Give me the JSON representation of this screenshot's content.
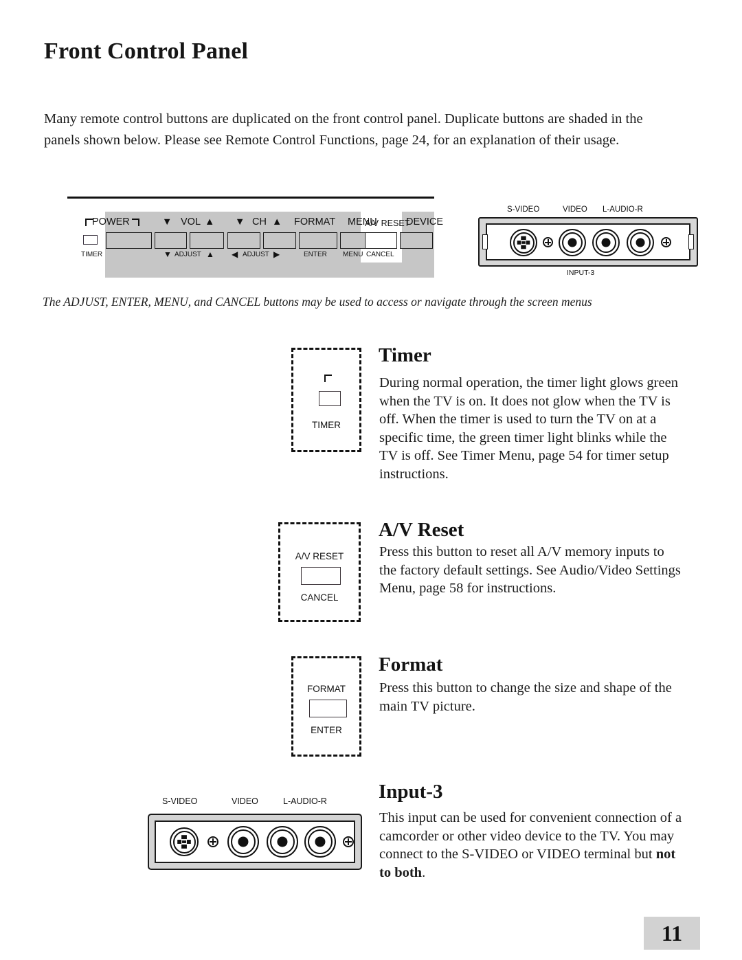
{
  "page": {
    "title": "Front Control Panel",
    "intro": "Many remote control buttons are duplicated on the front control panel.  Duplicate buttons are shaded in the\npanels shown below.  Please see Remote Control Functions, page 24, for an explanation of their usage.",
    "caption": "The ADJUST, ENTER, MENU, and CANCEL buttons may be used to access or navigate through the screen menus",
    "page_number": "11"
  },
  "control_panel": {
    "power_label": "POWER",
    "timer_label": "TIMER",
    "buttons": [
      {
        "top": "POWER",
        "bottom": ""
      },
      {
        "top": "▼  VOL",
        "bottom": "▼ ADJUST"
      },
      {
        "top": "VOL  ▲",
        "bottom": "ADJUST ▲"
      },
      {
        "top": "▼  CH",
        "bottom": "◀ ADJUST"
      },
      {
        "top": "CH  ▲",
        "bottom": "ADJUST ▶"
      },
      {
        "top": "FORMAT",
        "bottom": "ENTER"
      },
      {
        "top": "MENU",
        "bottom": "MENU"
      },
      {
        "top": "A/V RESET",
        "bottom": "CANCEL"
      },
      {
        "top": "DEVICE",
        "bottom": ""
      }
    ],
    "top_labels": {
      "vol": "VOL",
      "ch": "CH",
      "format": "FORMAT",
      "menu": "MENU",
      "av_reset": "A/V RESET",
      "device": "DEVICE"
    },
    "bottom_labels": {
      "adjust_v": "ADJUST",
      "adjust_h": "ADJUST",
      "enter": "ENTER",
      "menu": "MENU",
      "cancel": "CANCEL"
    },
    "arrows": {
      "down": "▼",
      "up": "▲",
      "left": "◀",
      "right": "▶"
    }
  },
  "input_panel_top": {
    "s_video": "S-VIDEO",
    "video": "VIDEO",
    "l_audio_r": "L-AUDIO-R",
    "input3": "INPUT-3"
  },
  "sections": {
    "timer": {
      "heading": "Timer",
      "body": "During normal operation, the timer light glows green\nwhen the TV is on.  It does not glow when the TV is\noff.  When the timer is used to turn the TV on at a\nspecific time, the green timer light blinks while the\nTV is off.  See Timer Menu, page 54 for timer setup\ninstructions.",
      "diagram_label": "TIMER"
    },
    "av_reset": {
      "heading": "A/V Reset",
      "body": "Press this button to reset all A/V memory inputs to\nthe factory default settings.  See Audio/Video Settings\nMenu, page 58 for instructions.",
      "diagram_top_label": "A/V RESET",
      "diagram_bottom_label": "CANCEL"
    },
    "format": {
      "heading": "Format",
      "body": "Press this button to change the size and shape of the\nmain TV picture.",
      "diagram_top_label": "FORMAT",
      "diagram_bottom_label": "ENTER"
    },
    "input3": {
      "heading": "Input-3",
      "body_part1": "This input can be used for convenient connection of a\ncamcorder or other video device to the TV.  You may\nconnect to the S-VIDEO or VIDEO terminal but ",
      "body_bold1": "not",
      "body_bold2": "to both",
      "body_part2": ".",
      "jack_s_video": "S-VIDEO",
      "jack_video": "VIDEO",
      "jack_l_audio_r": "L-AUDIO-R"
    }
  },
  "colors": {
    "panel_gray": "#c6c6c6",
    "bezel_gray": "#d7d7d7",
    "page_num_bg": "#d2d2d2",
    "ink": "#111111"
  }
}
